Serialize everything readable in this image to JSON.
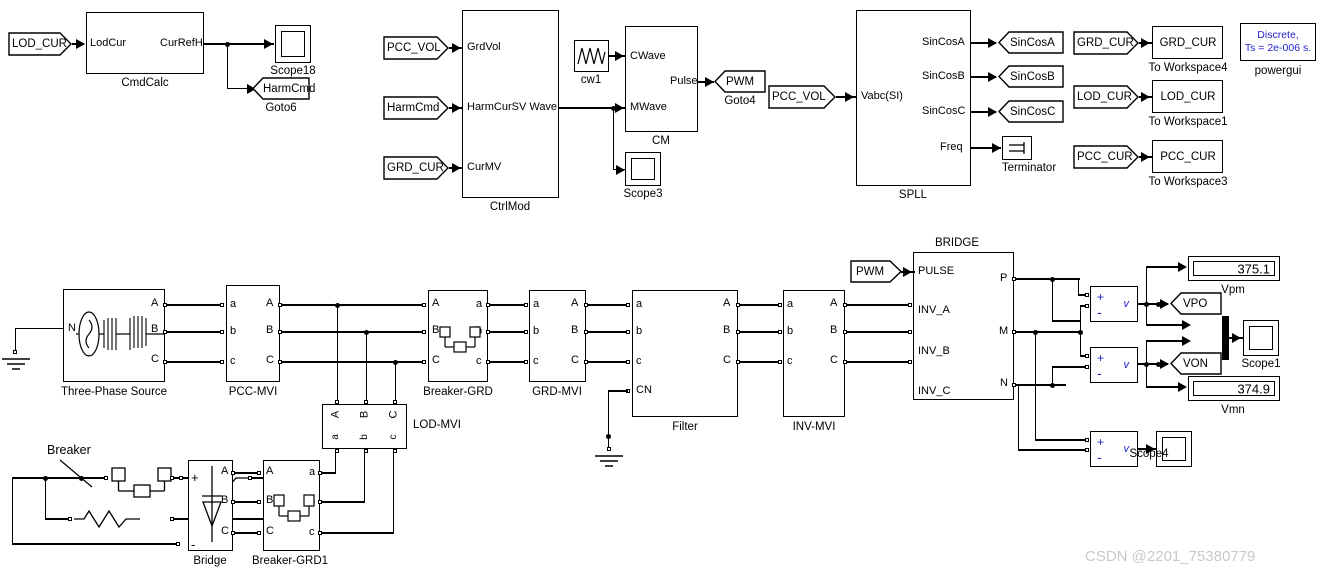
{
  "meta": {
    "watermark": "CSDN @2201_75380779"
  },
  "control": {
    "from_lod_cur": "LOD_CUR",
    "cmdcalc": {
      "name": "CmdCalc",
      "in": "LodCur",
      "out": "CurRefH"
    },
    "scope18": "Scope18",
    "goto_harmcmd": "HarmCmd",
    "goto6": "Goto6",
    "from_pcc_vol": "PCC_VOL",
    "from_harmcmd": "HarmCmd",
    "from_grd_cur": "GRD_CUR",
    "ctrlmod": {
      "name": "CtrlMod",
      "in1": "GrdVol",
      "in2": "HarmCurSV Wave",
      "in3": "CurMV"
    },
    "cw1": "cw1",
    "cm": {
      "name": "CM",
      "in1": "CWave",
      "in2": "MWave",
      "out": "Pulse"
    },
    "goto_pwm": "PWM",
    "goto4": "Goto4",
    "scope3": "Scope3",
    "from_pcc_vol2": "PCC_VOL",
    "spll": {
      "name": "SPLL",
      "in": "Vabc(SI)",
      "out1": "SinCosA",
      "out2": "SinCosB",
      "out3": "SinCosC",
      "out4": "Freq"
    },
    "goto_sincosa": "SinCosA",
    "goto_sincosb": "SinCosB",
    "goto_sincosc": "SinCosC",
    "terminator": "Terminator"
  },
  "workspace": {
    "rows": [
      {
        "from": "GRD_CUR",
        "block": "GRD_CUR",
        "label": "To Workspace4"
      },
      {
        "from": "LOD_CUR",
        "block": "LOD_CUR",
        "label": "To Workspace1"
      },
      {
        "from": "PCC_CUR",
        "block": "PCC_CUR",
        "label": "To Workspace3"
      }
    ],
    "powergui": {
      "line1": "Discrete,",
      "line2": "Ts = 2e-006 s.",
      "label": "powergui"
    }
  },
  "power": {
    "source": {
      "name": "Three-Phase Source",
      "pN": "N",
      "pA": "A",
      "pB": "B",
      "pC": "C"
    },
    "pcc_mvi": {
      "name": "PCC-MVI",
      "in": [
        "a",
        "b",
        "c"
      ],
      "out": [
        "A",
        "B",
        "C"
      ]
    },
    "breaker_grd": {
      "name": "Breaker-GRD",
      "in": [
        "A",
        "B",
        "C"
      ],
      "out": [
        "a",
        "b",
        "c"
      ]
    },
    "grd_mvi": {
      "name": "GRD-MVI",
      "in": [
        "a",
        "b",
        "c"
      ],
      "out": [
        "A",
        "B",
        "C"
      ]
    },
    "filter": {
      "name": "Filter",
      "in": [
        "a",
        "b",
        "c",
        "CN"
      ],
      "out": [
        "A",
        "B",
        "C"
      ]
    },
    "inv_mvi": {
      "name": "INV-MVI",
      "in": [
        "a",
        "b",
        "c"
      ],
      "out": [
        "A",
        "B",
        "C"
      ]
    },
    "lod_mvi": {
      "name": "LOD-MVI",
      "top": [
        "A",
        "B",
        "C"
      ],
      "bottom": [
        "a",
        "b",
        "c"
      ]
    },
    "bridge_top": {
      "name": "BRIDGE",
      "in": [
        "PULSE",
        "INV_A",
        "INV_B",
        "INV_C"
      ],
      "out": [
        "P",
        "M",
        "N"
      ],
      "from_pwm": "PWM"
    },
    "breaker_label": "Breaker",
    "bridge_bottom": {
      "name": "Bridge",
      "pPlus": "+",
      "pMinus": "-",
      "pA": "A",
      "pB": "B",
      "pC": "C"
    },
    "breaker_grd1": {
      "name": "Breaker-GRD1",
      "in": [
        "A",
        "B",
        "C"
      ],
      "out": [
        "a",
        "b",
        "c"
      ]
    }
  },
  "measure": {
    "vpm": {
      "value": "375.1",
      "label": "Vpm"
    },
    "vmn": {
      "value": "374.9",
      "label": "Vmn"
    },
    "goto_vpo": "VPO",
    "goto_von": "VON",
    "scope1": "Scope1",
    "scope4": "Scope4",
    "vm_plus": "+",
    "vm_minus": "-",
    "vm_v": "v"
  },
  "colors": {
    "line": "#000000",
    "text": "#000000",
    "powergui_text": "#2222cc",
    "watermark": "#c9c9c9"
  }
}
